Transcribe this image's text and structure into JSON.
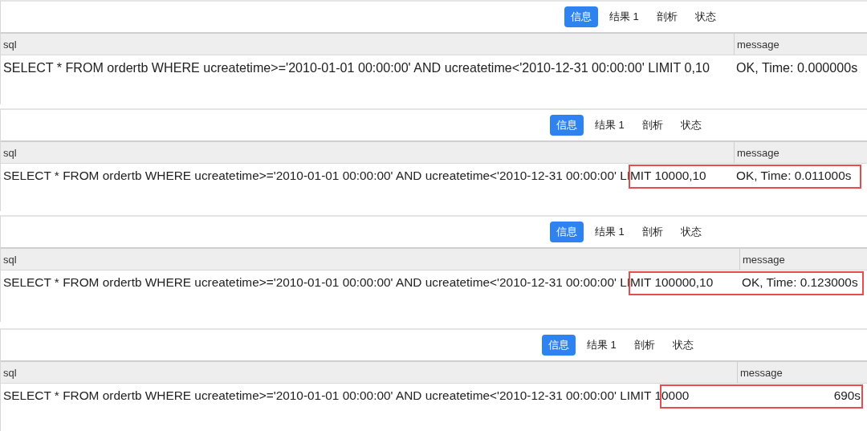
{
  "panels": [
    {
      "tabs": [
        {
          "label": "信息",
          "selected": true
        },
        {
          "label": "结果 1",
          "selected": false
        },
        {
          "label": "剖析",
          "selected": false
        },
        {
          "label": "状态",
          "selected": false
        }
      ],
      "columns": [
        "sql",
        "message"
      ],
      "row": {
        "sql": "SELECT * FROM ordertb WHERE ucreatetime>='2010-01-01 00:00:00' AND ucreatetime<'2010-12-31 00:00:00' LIMIT 0,10",
        "message": "OK, Time: 0.000000s"
      },
      "highlighted": false
    },
    {
      "tabs": [
        {
          "label": "信息",
          "selected": true
        },
        {
          "label": "结果 1",
          "selected": false
        },
        {
          "label": "剖析",
          "selected": false
        },
        {
          "label": "状态",
          "selected": false
        }
      ],
      "columns": [
        "sql",
        "message"
      ],
      "row": {
        "sql": "SELECT * FROM ordertb WHERE ucreatetime>='2010-01-01 00:00:00' AND ucreatetime<'2010-12-31 00:00:00' LIMIT 10000,10",
        "message": "OK, Time: 0.011000s"
      },
      "highlighted": true
    },
    {
      "tabs": [
        {
          "label": "信息",
          "selected": true
        },
        {
          "label": "结果 1",
          "selected": false
        },
        {
          "label": "剖析",
          "selected": false
        },
        {
          "label": "状态",
          "selected": false
        }
      ],
      "columns": [
        "sql",
        "message"
      ],
      "row": {
        "sql": "SELECT * FROM ordertb WHERE ucreatetime>='2010-01-01 00:00:00' AND ucreatetime<'2010-12-31 00:00:00' LIMIT 100000,10",
        "message": "OK, Time: 0.123000s"
      },
      "highlighted": true
    },
    {
      "tabs": [
        {
          "label": "信息",
          "selected": true
        },
        {
          "label": "结果 1",
          "selected": false
        },
        {
          "label": "剖析",
          "selected": false
        },
        {
          "label": "状态",
          "selected": false
        }
      ],
      "columns": [
        "sql",
        "message"
      ],
      "row": {
        "sql": "SELECT * FROM ordertb WHERE ucreatetime>='2010-01-01 00:00:00' AND ucreatetime<'2010-12-31 00:00:00' LIMIT 10000",
        "message": "690s"
      },
      "highlighted": true
    }
  ]
}
